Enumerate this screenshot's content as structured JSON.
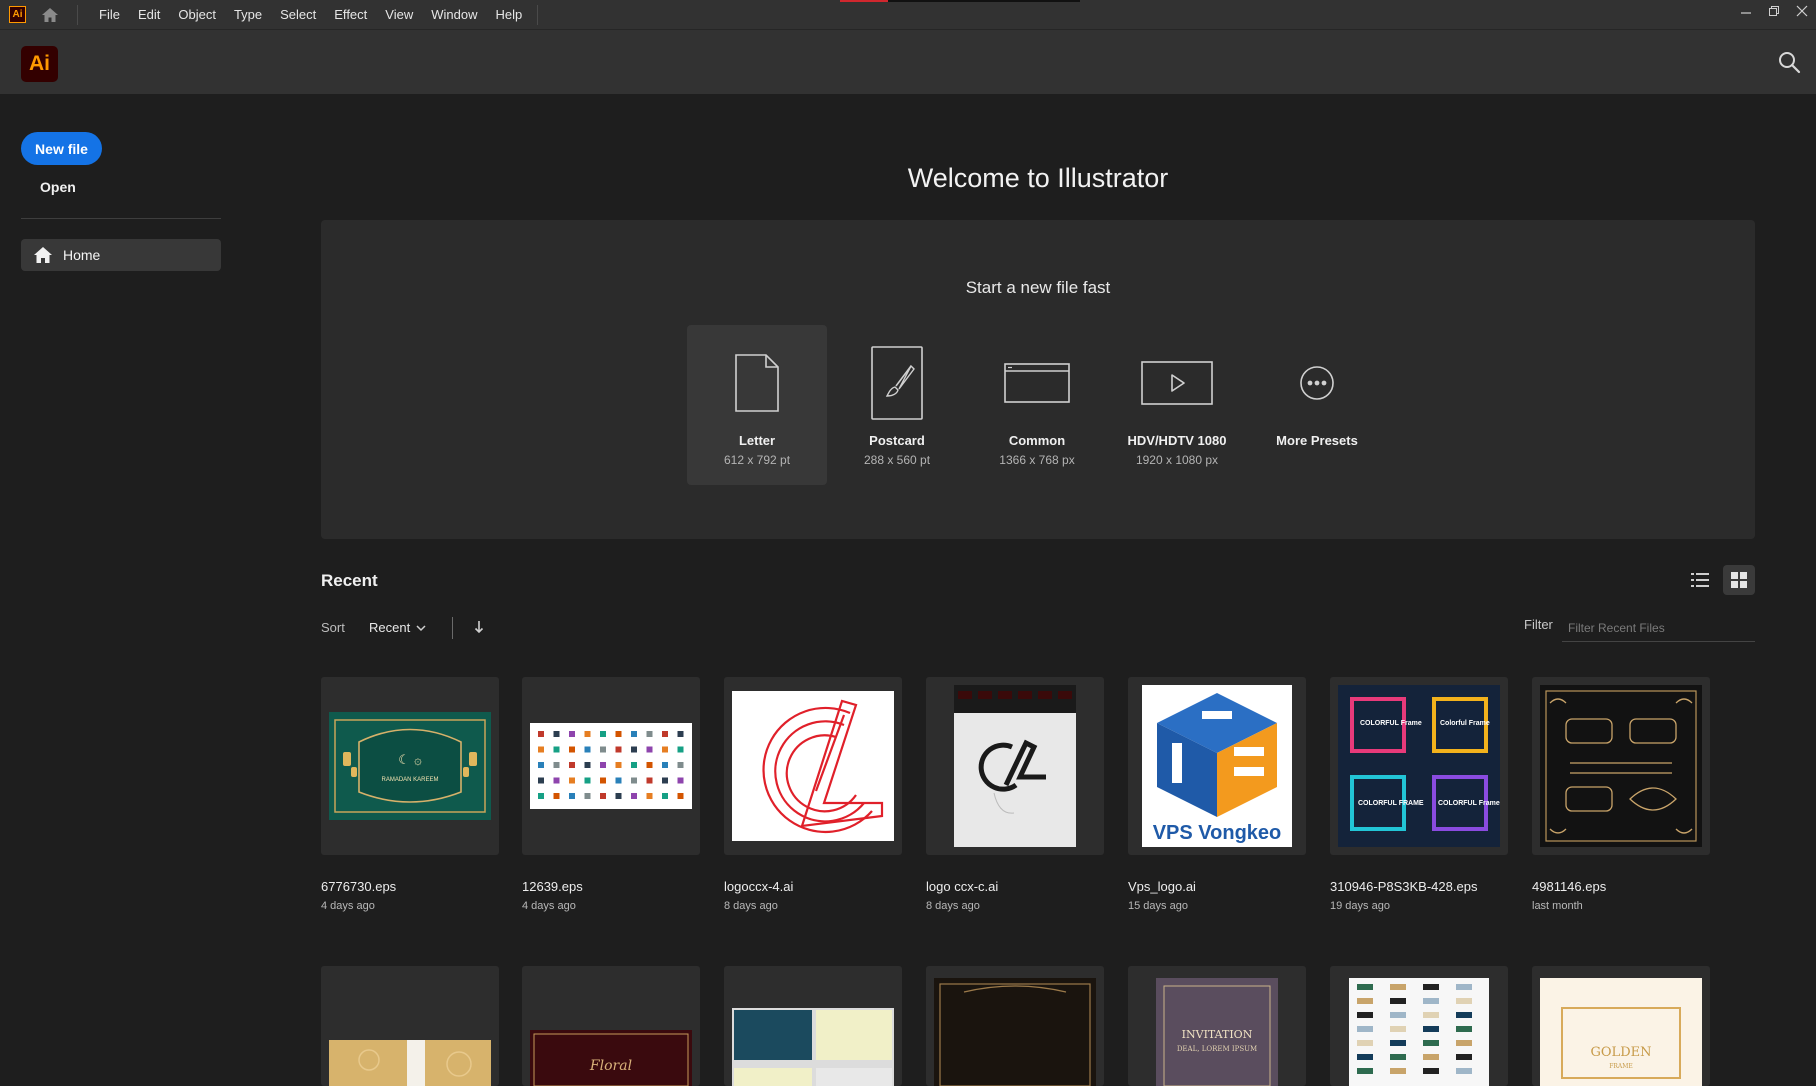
{
  "app": {
    "logo_text": "Ai",
    "brand_color": "#ff9a00",
    "brand_bg": "#330000",
    "accent": "#1473e6"
  },
  "menubar": {
    "items": [
      "File",
      "Edit",
      "Object",
      "Type",
      "Select",
      "Effect",
      "View",
      "Window",
      "Help"
    ]
  },
  "window_controls": [
    "minimize-icon",
    "restore-icon",
    "close-icon"
  ],
  "sidebar": {
    "new_file_label": "New file",
    "open_label": "Open",
    "nav": [
      {
        "label": "Home",
        "icon": "home-icon",
        "active": true
      }
    ]
  },
  "main": {
    "welcome_title": "Welcome to Illustrator",
    "presets_title": "Start a new file fast",
    "presets": [
      {
        "name": "Letter",
        "size": "612 x 792 pt",
        "icon": "document-icon",
        "selected": true
      },
      {
        "name": "Postcard",
        "size": "288 x 560 pt",
        "icon": "brush-icon",
        "selected": false
      },
      {
        "name": "Common",
        "size": "1366 x 768 px",
        "icon": "browser-window-icon",
        "selected": false
      },
      {
        "name": "HDV/HDTV 1080",
        "size": "1920 x 1080 px",
        "icon": "video-play-icon",
        "selected": false
      },
      {
        "name": "More Presets",
        "size": "",
        "icon": "more-icon",
        "selected": false
      }
    ],
    "recent": {
      "title": "Recent",
      "sort_label": "Sort",
      "sort_value": "Recent",
      "filter_label": "Filter",
      "filter_placeholder": "Filter Recent Files",
      "view_mode": "grid",
      "files": [
        {
          "name": "6776730.eps",
          "date": "4 days ago"
        },
        {
          "name": "12639.eps",
          "date": "4 days ago"
        },
        {
          "name": "logoccx-4.ai",
          "date": "8 days ago"
        },
        {
          "name": "logo ccx-c.ai",
          "date": "8 days ago"
        },
        {
          "name": "Vps_logo.ai",
          "date": "15 days ago"
        },
        {
          "name": "310946-P8S3KB-428.eps",
          "date": "19 days ago"
        },
        {
          "name": "4981146.eps",
          "date": "last month"
        }
      ],
      "thumbnail_text": {
        "ramadan": "RAMADAN KAREEM",
        "vps": "VPS Vongkeo",
        "frame_1": "COLORFUL Frame",
        "frame_2": "Colorful Frame",
        "frame_3": "COLORFUL FRAME",
        "frame_4": "COLORFUL Frame",
        "floral": "Floral",
        "invitation": "INVITATION",
        "invitation_sub": "DEAL, LOREM IPSUM",
        "golden": "GOLDEN",
        "golden_sub": "FRAME"
      }
    }
  }
}
